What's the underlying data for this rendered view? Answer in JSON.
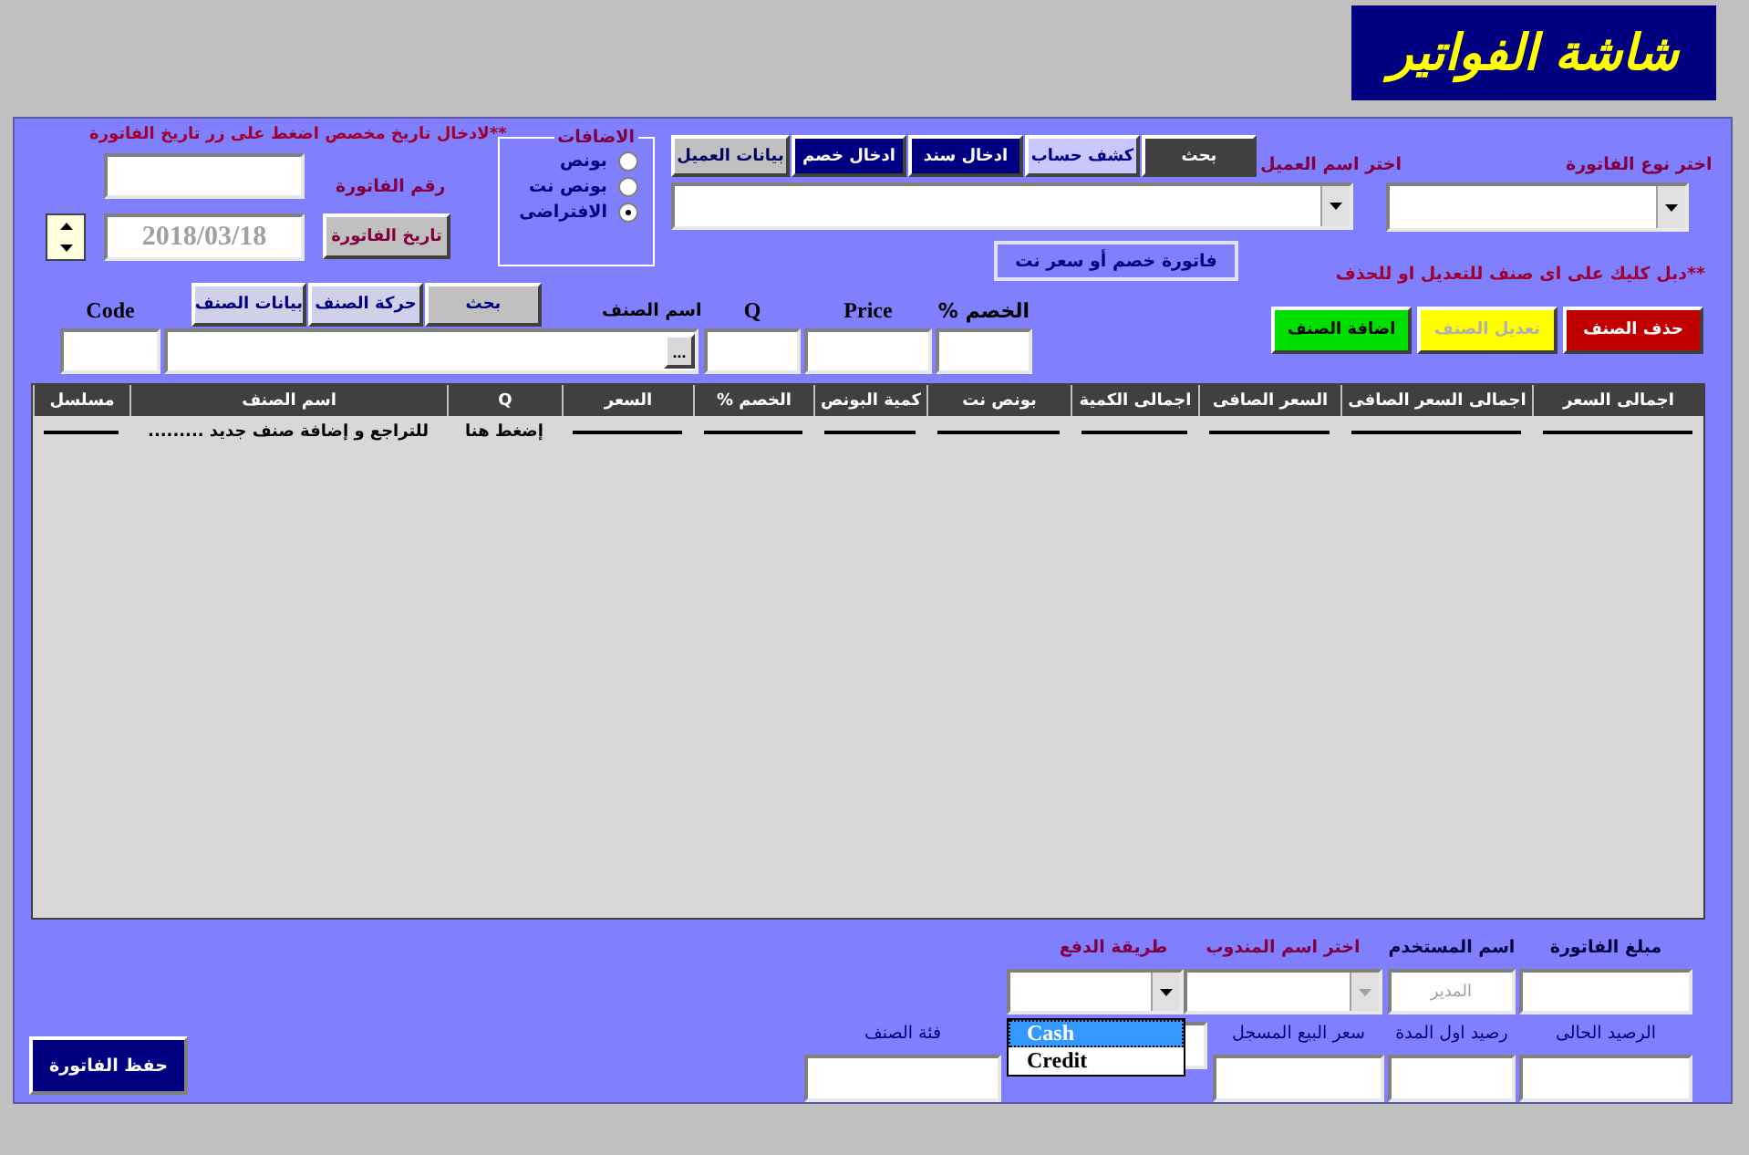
{
  "title": "شاشة الفواتير",
  "date_hint": "**لادخال تاريخ مخصص اضغط على زر تاريخ الفاتورة",
  "invoice_number": {
    "label": "رقم الفاتورة"
  },
  "invoice_date": {
    "value": "2018/03/18",
    "button": "تاريخ الفاتورة"
  },
  "additions": {
    "title": "الاضافات",
    "options": [
      {
        "label": "بونص",
        "selected": false
      },
      {
        "label": "بونص نت",
        "selected": false
      },
      {
        "label": "الافتراضى",
        "selected": true
      }
    ]
  },
  "client_buttons": [
    {
      "label": "بحث",
      "kind": "dark"
    },
    {
      "label": "كشف حساب",
      "kind": "lavender"
    },
    {
      "label": "ادخال سند",
      "kind": "navy"
    },
    {
      "label": "ادخال خصم",
      "kind": "navy"
    },
    {
      "label": "بيانات العميل",
      "kind": "grey"
    }
  ],
  "client": {
    "label": "اختر اسم العميل"
  },
  "invoice_type": {
    "label": "اختر نوع الفاتورة"
  },
  "discount_invoice": "فاتورة خصم أو سعر نت",
  "edit_hint": "**دبل كليك على اى صنف للتعديل او للحذف",
  "item_labels": {
    "code": "Code",
    "name": "اسم الصنف",
    "q": "Q",
    "price": "Price",
    "discount": "الخصم %"
  },
  "item_buttons": [
    "بحث",
    "حركة الصنف",
    "بيانات الصنف"
  ],
  "browse_button": "...",
  "item_actions": [
    {
      "label": "حذف الصنف",
      "kind": "delete",
      "disabled": false
    },
    {
      "label": "تعديل الصنف",
      "kind": "edit",
      "disabled": true
    },
    {
      "label": "اضافة الصنف",
      "kind": "add",
      "disabled": false
    }
  ],
  "table": {
    "columns": [
      "اجمالى السعر",
      "اجمالى السعر الصافى",
      "السعر الصافى",
      "اجمالى الكمية",
      "بونص نت",
      "كمية البونص",
      "الخصم %",
      "السعر",
      "Q",
      "اسم الصنف",
      "مسلسل"
    ],
    "rows": [
      {
        "cells": [
          {
            "kind": "line"
          },
          {
            "kind": "line"
          },
          {
            "kind": "line"
          },
          {
            "kind": "line"
          },
          {
            "kind": "line"
          },
          {
            "kind": "line"
          },
          {
            "kind": "line"
          },
          {
            "kind": "line"
          },
          {
            "kind": "text",
            "text": "إضغط هنا"
          },
          {
            "kind": "text",
            "text": "للتراجع و إضافة صنف جديد ........."
          },
          {
            "kind": "line"
          }
        ]
      }
    ]
  },
  "payment": {
    "label": "طريقة الدفع",
    "options": [
      {
        "label": "Cash",
        "selected": true
      },
      {
        "label": "Credit",
        "selected": false
      }
    ]
  },
  "rep": {
    "label": "اختر اسم المندوب",
    "disabled": true
  },
  "user": {
    "label": "اسم المستخدم",
    "value": "المدير"
  },
  "amount": {
    "label": "مبلغ الفاتورة"
  },
  "category": {
    "label": "فئة الصنف"
  },
  "sale_price": {
    "label": "سعر البيع المسجل"
  },
  "opening_balance": {
    "label": "رصيد اول المدة"
  },
  "current_balance": {
    "label": "الرصيد الحالى"
  },
  "save_button": "حفظ الفاتورة"
}
